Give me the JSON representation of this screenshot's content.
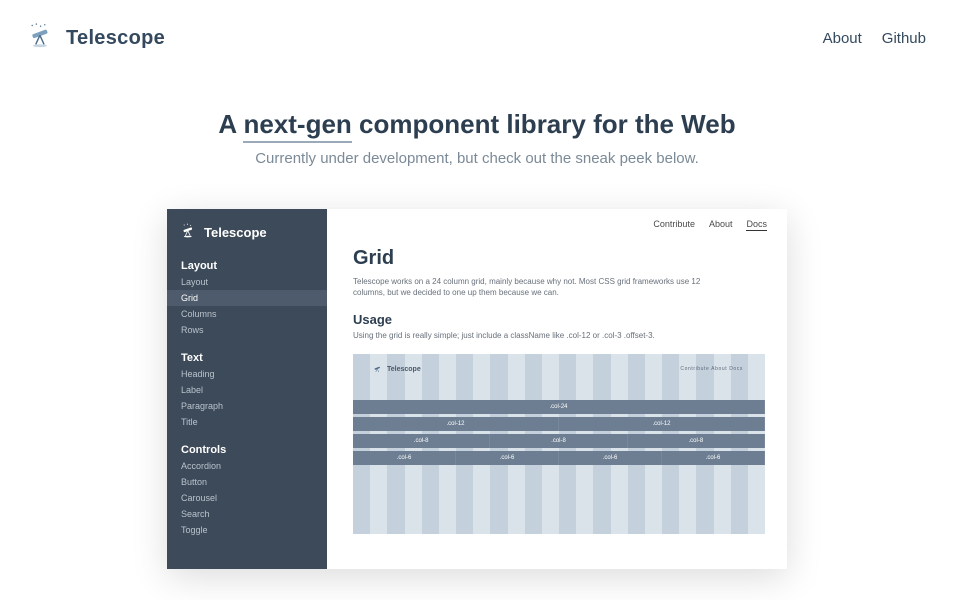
{
  "brand": "Telescope",
  "nav": {
    "about": "About",
    "github": "Github"
  },
  "hero": {
    "pre": "A",
    "highlight": "next-gen",
    "post": "component library for the Web",
    "sub": "Currently under development, but check out the sneak peek below."
  },
  "sidebar": {
    "brand": "Telescope",
    "groups": [
      {
        "title": "Layout",
        "items": [
          "Layout",
          "Grid",
          "Columns",
          "Rows"
        ],
        "active": "Grid"
      },
      {
        "title": "Text",
        "items": [
          "Heading",
          "Label",
          "Paragraph",
          "Title"
        ]
      },
      {
        "title": "Controls",
        "items": [
          "Accordion",
          "Button",
          "Carousel",
          "Search",
          "Toggle"
        ]
      }
    ]
  },
  "contentNav": {
    "contribute": "Contribute",
    "about": "About",
    "docs": "Docs"
  },
  "page": {
    "title": "Grid",
    "desc": "Telescope works on a 24 column grid, mainly because why not. Most CSS grid frameworks use 12 columns, but we decided to one up them because we can.",
    "usageTitle": "Usage",
    "usageDesc": "Using the grid is really simple; just include a className like .col-12 or .col-3 .offset-3."
  },
  "grid": {
    "brand": "Telescope",
    "nav": "Contribute  About  Docs",
    "rows": [
      [
        ".col-24"
      ],
      [
        ".col-12",
        ".col-12"
      ],
      [
        ".col-8",
        ".col-8",
        ".col-8"
      ],
      [
        ".col-6",
        ".col-6",
        ".col-6",
        ".col-6"
      ]
    ]
  }
}
